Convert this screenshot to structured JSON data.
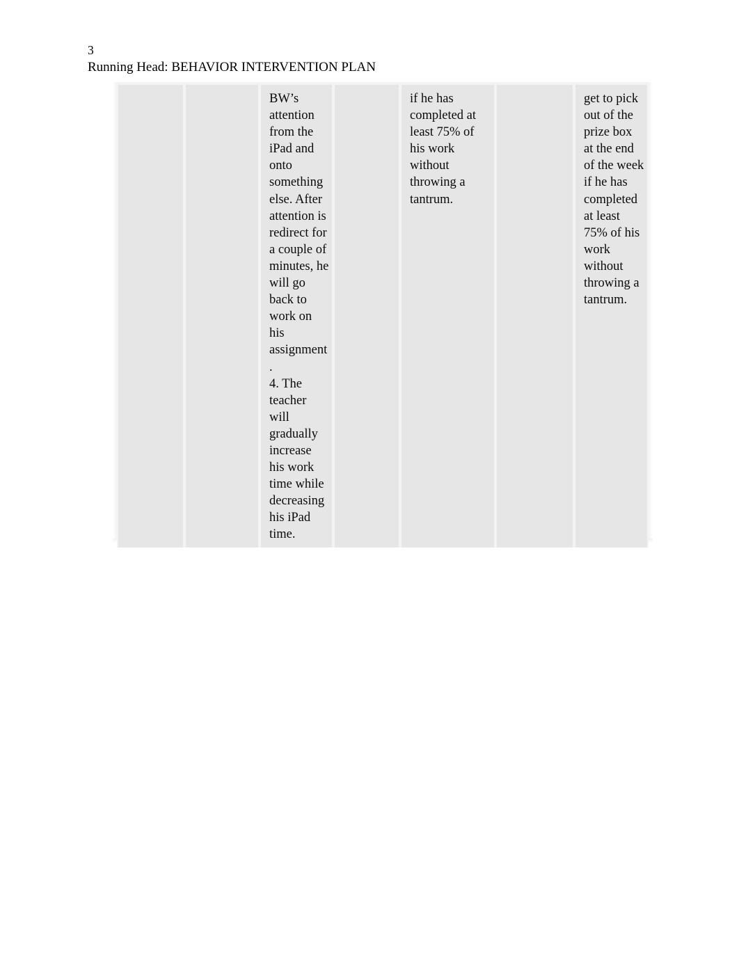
{
  "document": {
    "page_number": "3",
    "running_head": "Running Head: BEHAVIOR INTERVENTION PLAN",
    "background_color": "#ffffff",
    "text_color": "#000000"
  },
  "table": {
    "cell_fill_color": "#e6e6e6",
    "gridline_color": "#f3f3f3",
    "columns": 7,
    "rows": 1,
    "cells": {
      "col1": "",
      "col2": "",
      "col3": "BW’s attention from the iPad and onto something else. After attention is redirect for a couple of minutes, he will go back to work on his assignment.\n4. The teacher will gradually increase his work time while decreasing his iPad time.",
      "col4": "",
      "col5": "if he has completed at least 75% of his work without throwing a tantrum.",
      "col6": "",
      "col7": "get to pick out of the prize box at the end of the week if he has completed at least 75% of his work without throwing a tantrum."
    }
  }
}
